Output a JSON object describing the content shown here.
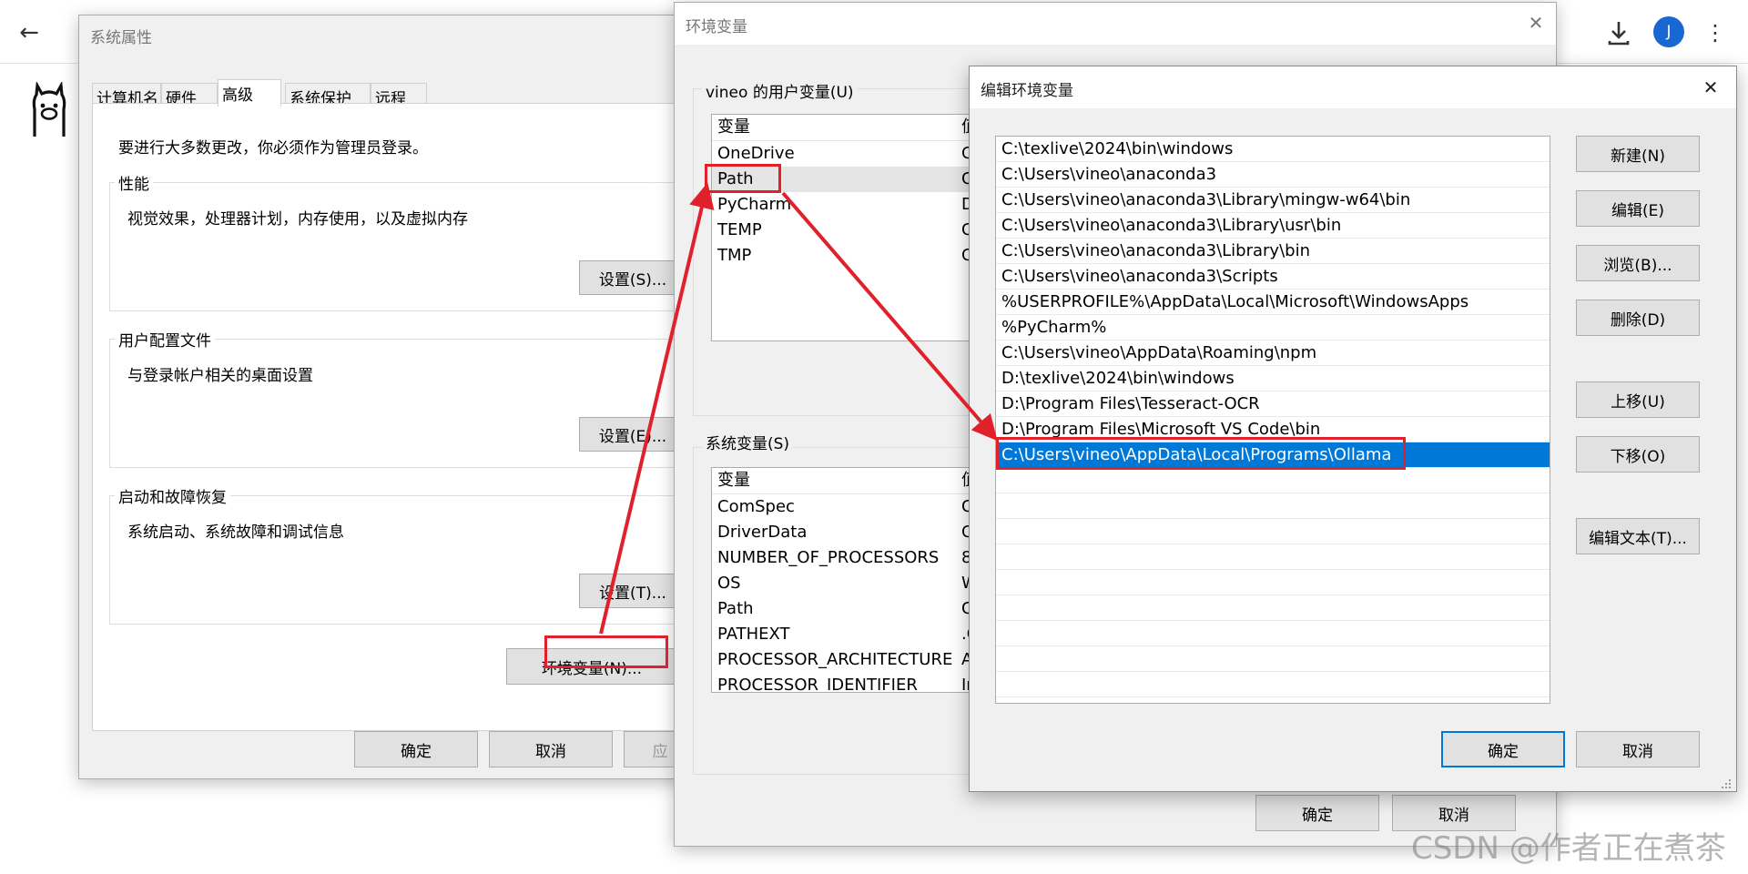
{
  "browser": {
    "back_glyph": "←",
    "avatar_letter": "J",
    "menu_glyph": "⋮"
  },
  "system_properties": {
    "title": "系统属性",
    "tabs": [
      "计算机名",
      "硬件",
      "高级",
      "系统保护",
      "远程"
    ],
    "active_tab": "高级",
    "notice": "要进行大多数更改，你必须作为管理员登录。",
    "performance": {
      "label": "性能",
      "desc": "视觉效果，处理器计划，内存使用，以及虚拟内存",
      "button": "设置(S)..."
    },
    "user_profiles": {
      "label": "用户配置文件",
      "desc": "与登录帐户相关的桌面设置",
      "button": "设置(E)..."
    },
    "startup_recovery": {
      "label": "启动和故障恢复",
      "desc": "系统启动、系统故障和调试信息",
      "button": "设置(T)..."
    },
    "env_button": "环境变量(N)...",
    "ok": "确定",
    "cancel": "取消",
    "apply_partial": "应"
  },
  "env_vars": {
    "title": "环境变量",
    "close_glyph": "✕",
    "user_section": "vineo 的用户变量(U)",
    "user_columns": [
      "变量",
      "值"
    ],
    "user_rows": [
      {
        "name": "OneDrive",
        "value": "C"
      },
      {
        "name": "Path",
        "value": "C"
      },
      {
        "name": "PyCharm",
        "value": "D"
      },
      {
        "name": "TEMP",
        "value": "C"
      },
      {
        "name": "TMP",
        "value": "C"
      }
    ],
    "system_section": "系统变量(S)",
    "system_columns": [
      "变量",
      "值"
    ],
    "system_rows": [
      {
        "name": "ComSpec",
        "value": "C"
      },
      {
        "name": "DriverData",
        "value": "C"
      },
      {
        "name": "NUMBER_OF_PROCESSORS",
        "value": "8"
      },
      {
        "name": "OS",
        "value": "W"
      },
      {
        "name": "Path",
        "value": "C"
      },
      {
        "name": "PATHEXT",
        "value": ".C"
      },
      {
        "name": "PROCESSOR_ARCHITECTURE",
        "value": "A"
      },
      {
        "name": "PROCESSOR_IDENTIFIER",
        "value": "In"
      }
    ],
    "ok": "确定",
    "cancel": "取消"
  },
  "edit_env": {
    "title": "编辑环境变量",
    "close_glyph": "✕",
    "paths": [
      "C:\\texlive\\2024\\bin\\windows",
      "C:\\Users\\vineo\\anaconda3",
      "C:\\Users\\vineo\\anaconda3\\Library\\mingw-w64\\bin",
      "C:\\Users\\vineo\\anaconda3\\Library\\usr\\bin",
      "C:\\Users\\vineo\\anaconda3\\Library\\bin",
      "C:\\Users\\vineo\\anaconda3\\Scripts",
      "%USERPROFILE%\\AppData\\Local\\Microsoft\\WindowsApps",
      "%PyCharm%",
      "C:\\Users\\vineo\\AppData\\Roaming\\npm",
      "D:\\texlive\\2024\\bin\\windows",
      "D:\\Program Files\\Tesseract-OCR",
      "D:\\Program Files\\Microsoft VS Code\\bin",
      "C:\\Users\\vineo\\AppData\\Local\\Programs\\Ollama"
    ],
    "selected_index": 12,
    "buttons": {
      "new": "新建(N)",
      "edit": "编辑(E)",
      "browse": "浏览(B)...",
      "delete": "删除(D)",
      "move_up": "上移(U)",
      "move_down": "下移(O)",
      "edit_text": "编辑文本(T)..."
    },
    "ok": "确定",
    "cancel": "取消"
  },
  "annotation_color": "#e0202a",
  "watermark": "CSDN @作者正在煮茶"
}
